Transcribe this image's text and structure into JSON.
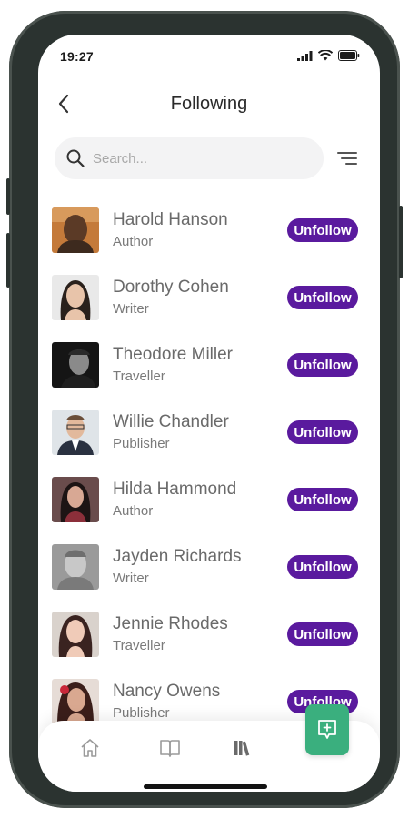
{
  "status_bar": {
    "time": "19:27"
  },
  "header": {
    "title": "Following"
  },
  "search": {
    "placeholder": "Search..."
  },
  "users": [
    {
      "name": "Harold Hanson",
      "role": "Author",
      "action": "Unfollow"
    },
    {
      "name": "Dorothy Cohen",
      "role": "Writer",
      "action": "Unfollow"
    },
    {
      "name": "Theodore Miller",
      "role": "Traveller",
      "action": "Unfollow"
    },
    {
      "name": "Willie Chandler",
      "role": "Publisher",
      "action": "Unfollow"
    },
    {
      "name": "Hilda Hammond",
      "role": "Author",
      "action": "Unfollow"
    },
    {
      "name": "Jayden Richards",
      "role": "Writer",
      "action": "Unfollow"
    },
    {
      "name": "Jennie Rhodes",
      "role": "Traveller",
      "action": "Unfollow"
    },
    {
      "name": "Nancy Owens",
      "role": "Publisher",
      "action": "Unfollow"
    }
  ],
  "tabbar": {
    "items": [
      {
        "icon": "home-icon"
      },
      {
        "icon": "book-icon"
      },
      {
        "icon": "library-icon",
        "active": true
      }
    ],
    "fab_icon": "add-message-icon"
  },
  "colors": {
    "accent": "#5a1a9e",
    "fab": "#3aaf7e",
    "frame": "#2b3330"
  }
}
